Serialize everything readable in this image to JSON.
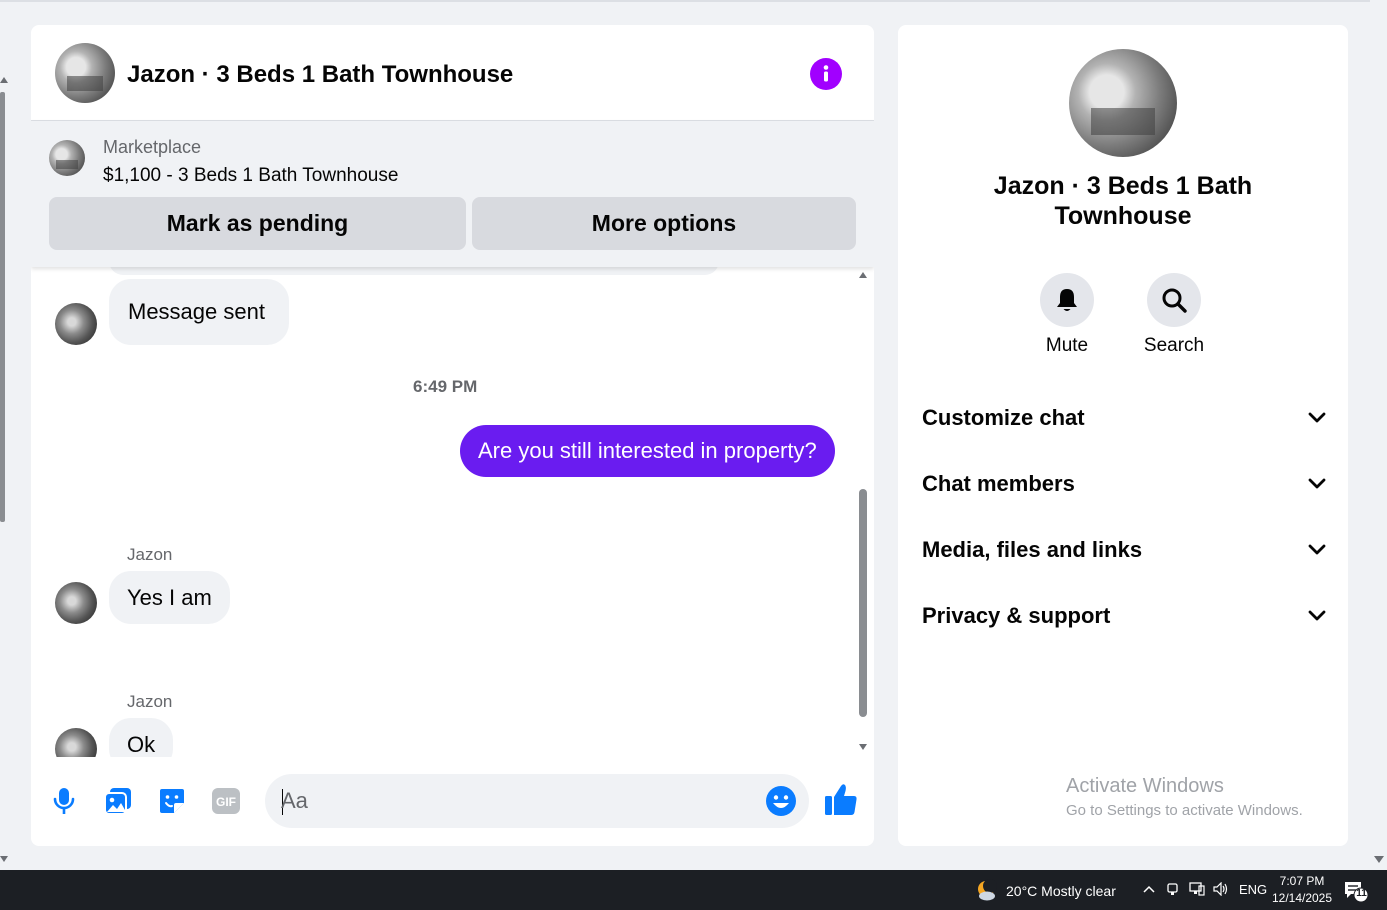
{
  "chat": {
    "title": "Jazon · 3 Beds 1 Bath Townhouse",
    "marketplace": {
      "label": "Marketplace",
      "listing": "$1,100 - 3 Beds 1 Bath Townhouse",
      "mark_pending_label": "Mark as pending",
      "more_options_label": "More options"
    },
    "messages": {
      "first": "Message sent",
      "timestamp": "6:49 PM",
      "outgoing": "Are you still interested in property?",
      "sender_1": "Jazon",
      "reply_1": "Yes I am",
      "sender_2": "Jazon",
      "reply_2": "Ok"
    },
    "composer": {
      "placeholder": "Aa",
      "icons": [
        "microphone-icon",
        "image-icon",
        "sticker-icon",
        "gif-icon",
        "emoji-icon",
        "thumbs-up-icon"
      ]
    }
  },
  "info": {
    "title": "Jazon · 3 Beds 1 Bath Townhouse",
    "actions": {
      "mute": "Mute",
      "search": "Search"
    },
    "sections": [
      "Customize chat",
      "Chat members",
      "Media, files and links",
      "Privacy & support"
    ],
    "watermark_title": "Activate Windows",
    "watermark_sub": "Go to Settings to activate Windows."
  },
  "taskbar": {
    "weather": "20°C  Mostly clear",
    "language": "ENG",
    "time": "7:07 PM",
    "date": "12/14/2025",
    "notifications": "11"
  },
  "colors": {
    "accent": "#a100ff",
    "outgoing_bubble": "#6a1cf0",
    "icon_blue": "#0a7cff"
  }
}
